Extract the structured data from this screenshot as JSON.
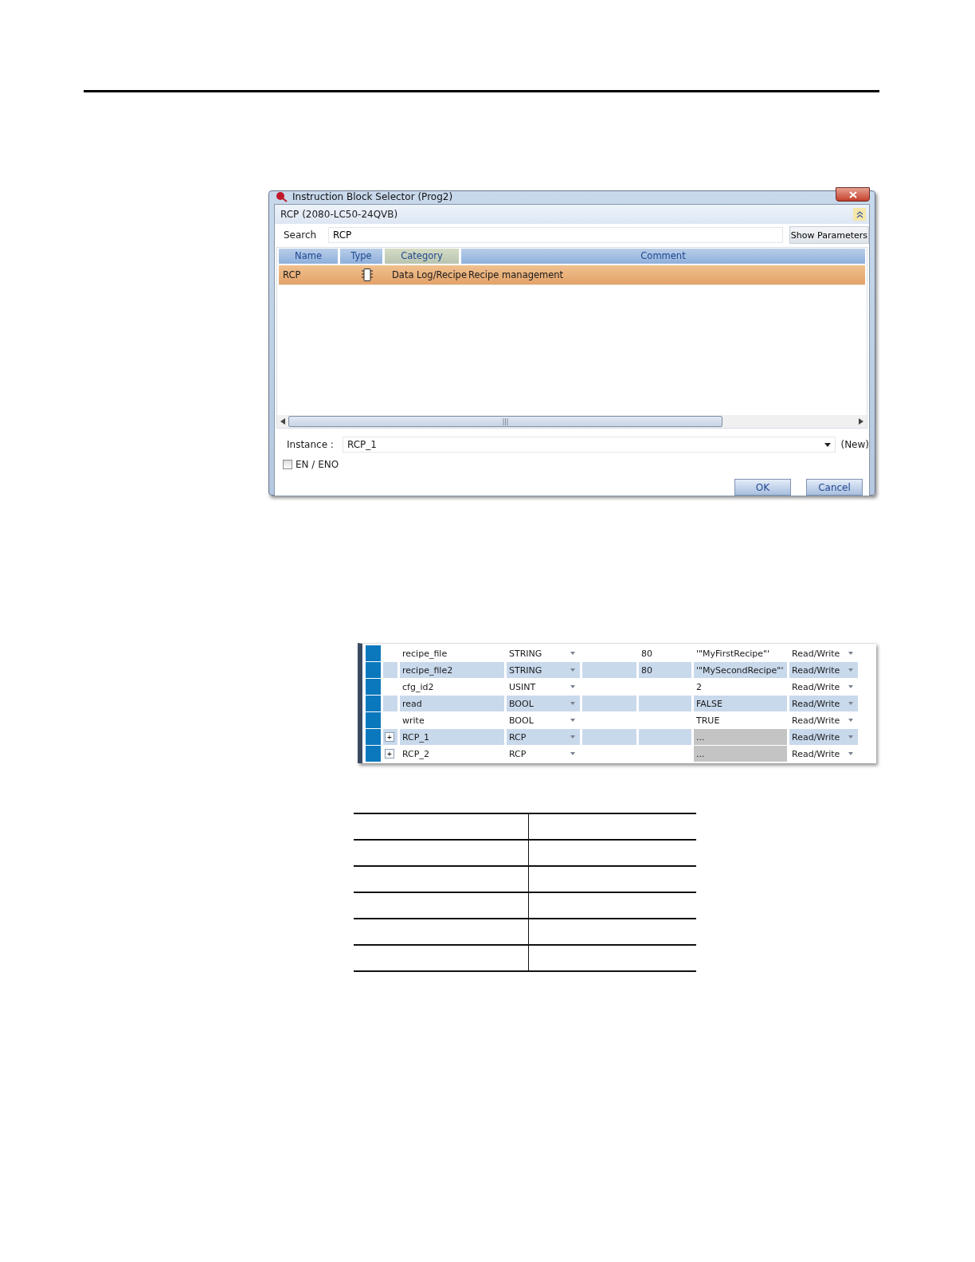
{
  "dialog": {
    "title": "Instruction Block Selector (Prog2)",
    "header": "RCP (2080-LC50-24QVB)",
    "search": {
      "label": "Search",
      "value": "RCP"
    },
    "show_parameters": "Show Parameters",
    "columns": [
      "Name",
      "Type",
      "Category",
      "Comment"
    ],
    "rows": [
      {
        "name": "RCP",
        "category": "Data Log/Recipe",
        "comment": "Recipe management",
        "selected": true
      }
    ],
    "instance": {
      "label": "Instance :",
      "value": "RCP_1",
      "note": "(New)"
    },
    "en_eno": {
      "label": "EN / ENO",
      "checked": false
    },
    "buttons": [
      "OK",
      "Cancel"
    ]
  },
  "variables": [
    {
      "name": "recipe_file",
      "type": "STRING",
      "length": "80",
      "value": "'\"MyFirstRecipe\"'",
      "access": "Read/Write",
      "value_disabled": false
    },
    {
      "name": "recipe_file2",
      "type": "STRING",
      "length": "80",
      "value": "'\"MySecondRecipe\"'",
      "access": "Read/Write",
      "value_disabled": false
    },
    {
      "name": "cfg_id2",
      "type": "USINT",
      "value": "2",
      "access": "Read/Write",
      "value_disabled": false
    },
    {
      "name": "read",
      "type": "BOOL",
      "value": "FALSE",
      "access": "Read/Write",
      "value_disabled": false
    },
    {
      "name": "write",
      "type": "BOOL",
      "value": "TRUE",
      "access": "Read/Write",
      "value_disabled": false
    },
    {
      "expander": "+",
      "name": "RCP_1",
      "type": "RCP",
      "value": "...",
      "access": "Read/Write",
      "value_disabled": true
    },
    {
      "expander": "+",
      "name": "RCP_2",
      "type": "RCP",
      "value": "...",
      "access": "Read/Write",
      "value_disabled": true
    }
  ]
}
